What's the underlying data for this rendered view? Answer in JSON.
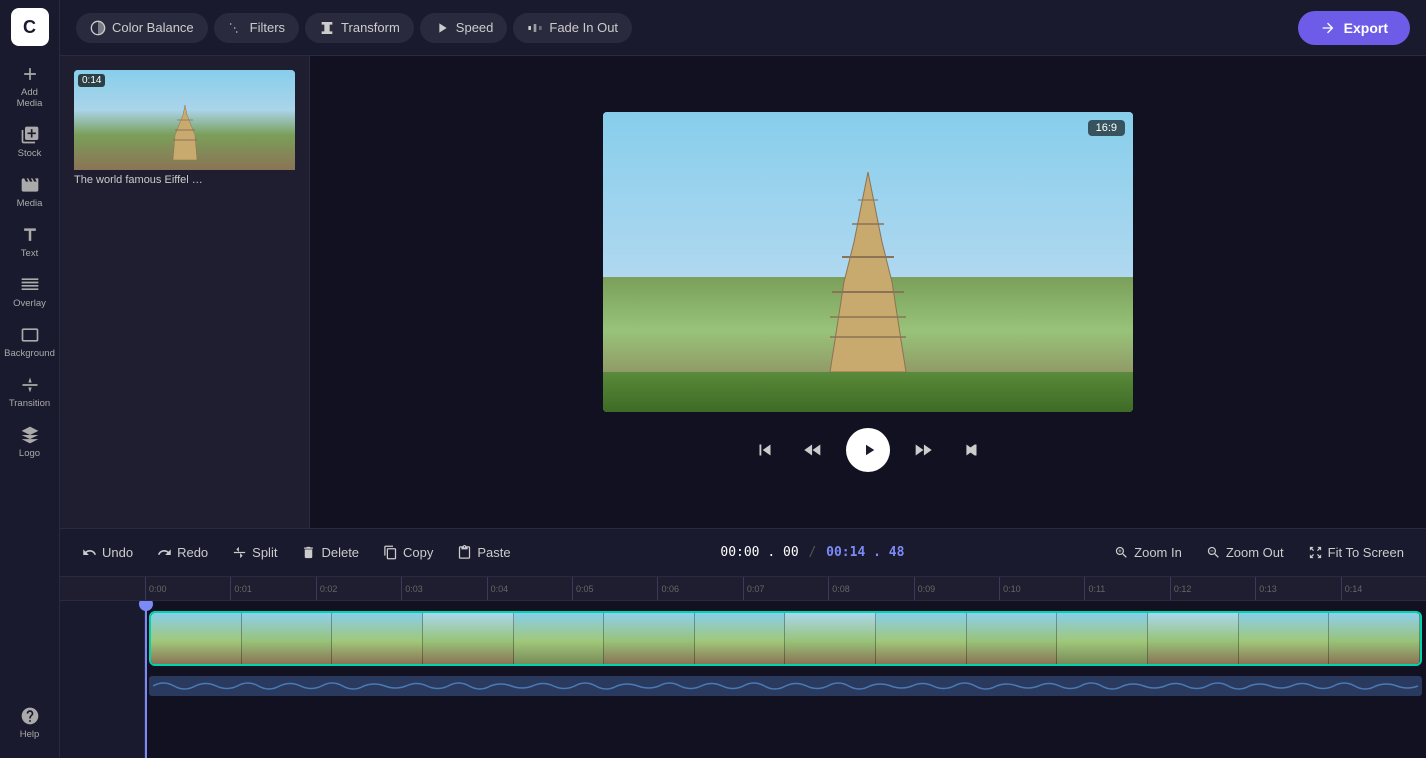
{
  "app": {
    "logo": "C",
    "aspect_ratio": "16:9"
  },
  "sidebar": {
    "items": [
      {
        "id": "add-media",
        "label": "Add Media",
        "icon": "plus"
      },
      {
        "id": "stock",
        "label": "Stock",
        "icon": "stock"
      },
      {
        "id": "media",
        "label": "Media",
        "icon": "film"
      },
      {
        "id": "text",
        "label": "Text",
        "icon": "text"
      },
      {
        "id": "overlay",
        "label": "Overlay",
        "icon": "overlay"
      },
      {
        "id": "background",
        "label": "Background",
        "icon": "background"
      },
      {
        "id": "transition",
        "label": "Transition",
        "icon": "transition"
      },
      {
        "id": "logo",
        "label": "Logo",
        "icon": "logo"
      },
      {
        "id": "help",
        "label": "Help",
        "icon": "help"
      }
    ]
  },
  "topbar": {
    "tools": [
      {
        "id": "color-balance",
        "label": "Color Balance",
        "icon": "circle"
      },
      {
        "id": "filters",
        "label": "Filters",
        "icon": "filters"
      },
      {
        "id": "transform",
        "label": "Transform",
        "icon": "transform"
      },
      {
        "id": "speed",
        "label": "Speed",
        "icon": "speed"
      },
      {
        "id": "fade-in-out",
        "label": "Fade In Out",
        "icon": "fade"
      }
    ],
    "export_label": "Export"
  },
  "media_panel": {
    "items": [
      {
        "id": "eiffel-clip",
        "duration": "0:14",
        "title": "The world famous Eiffel …"
      }
    ]
  },
  "preview": {
    "aspect_ratio": "16:9"
  },
  "timeline": {
    "toolbar": {
      "undo_label": "Undo",
      "redo_label": "Redo",
      "split_label": "Split",
      "delete_label": "Delete",
      "copy_label": "Copy",
      "paste_label": "Paste",
      "zoom_in_label": "Zoom In",
      "zoom_out_label": "Zoom Out",
      "fit_to_screen_label": "Fit To Screen"
    },
    "time_current": "00:00 . 00",
    "time_separator": "/",
    "time_total": "00:14 . 48",
    "ruler_marks": [
      "0:00",
      "0:01",
      "0:02",
      "0:03",
      "0:04",
      "0:05",
      "0:06",
      "0:07",
      "0:08",
      "0:09",
      "0:10",
      "0:11",
      "0:12",
      "0:13",
      "0:14"
    ]
  }
}
